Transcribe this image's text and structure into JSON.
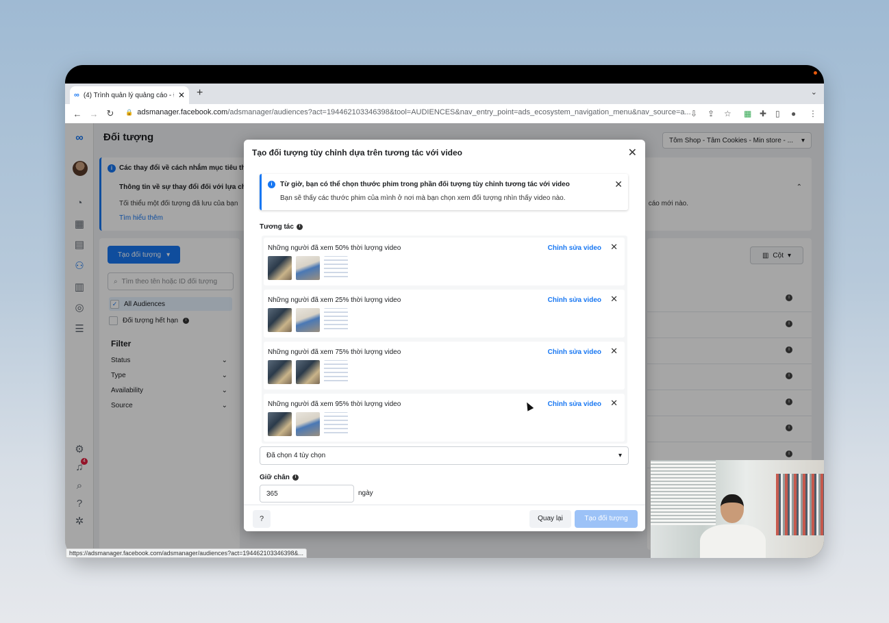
{
  "browser": {
    "tab_title": "(4) Trình quản lý quảng cáo - Đ",
    "url_host": "adsmanager.facebook.com",
    "url_path": "/adsmanager/audiences?act=194462103346398&tool=AUDIENCES&nav_entry_point=ads_ecosystem_navigation_menu&nav_source=a...",
    "status_url": "https://adsmanager.facebook.com/adsmanager/audiences?act=194462103346398&..."
  },
  "page": {
    "title": "Đối tượng",
    "account_selector": "Tôm Shop - Tâm Cookies - Min store - ..."
  },
  "notice": {
    "title": "Các thay đổi về cách nhắm mục tiêu th",
    "subtitle": "Thông tin về sự thay đổi đối với lựa ch",
    "body": "Tối thiểu một đối tượng đã lưu của bạn",
    "body_right": "cáo mới nào.",
    "link": "Tìm hiểu thêm"
  },
  "left_panel": {
    "create_button": "Tạo đối tượng",
    "search_placeholder": "Tìm theo tên hoặc ID đối tượng",
    "audience_items": [
      "All Audiences",
      "Đối tượng hết hạn"
    ],
    "filter_heading": "Filter",
    "filters": [
      "Status",
      "Type",
      "Availability",
      "Source"
    ]
  },
  "right_panel": {
    "columns_button": "Cột"
  },
  "modal": {
    "title": "Tạo đối tượng tùy chỉnh dựa trên tương tác với video",
    "info_title": "Từ giờ, bạn có thể chọn thước phim trong phần đối tượng tùy chỉnh tương tác với video",
    "info_body": "Bạn sẽ thấy các thước phim của mình ở nơi mà bạn chọn xem đối tượng nhìn thấy video nào.",
    "engagement_label": "Tương tác",
    "engagements": [
      {
        "text": "Những người đã xem 50% thời lượng video",
        "edit": "Chỉnh sửa video"
      },
      {
        "text": "Những người đã xem 25% thời lượng video",
        "edit": "Chỉnh sửa video"
      },
      {
        "text": "Những người đã xem 75% thời lượng video",
        "edit": "Chỉnh sửa video"
      },
      {
        "text": "Những người đã xem 95% thời lượng video",
        "edit": "Chỉnh sửa video"
      }
    ],
    "selected_summary": "Đã chọn 4 tùy chọn",
    "retention_label": "Giữ chân",
    "retention_value": "365",
    "retention_unit": "ngày",
    "back_button": "Quay lại",
    "create_button": "Tạo đối tượng"
  },
  "colors": {
    "accent": "#1877f2",
    "disabled_button": "#9cc2f7"
  },
  "icons": [
    "meta-logo-icon",
    "lock-icon",
    "info-icon",
    "close-icon",
    "chevron-down-icon",
    "search-icon",
    "help-icon",
    "settings-icon",
    "bell-icon",
    "bug-icon",
    "columns-icon"
  ],
  "notifications_count": "4"
}
